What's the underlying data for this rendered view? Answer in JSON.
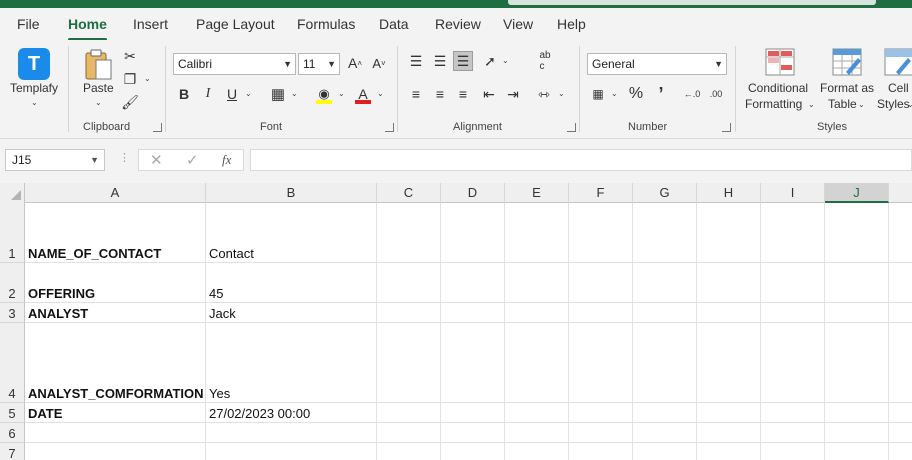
{
  "menu_tabs": [
    "File",
    "Home",
    "Insert",
    "Page Layout",
    "Formulas",
    "Data",
    "Review",
    "View",
    "Help"
  ],
  "ribbon": {
    "templafy": {
      "label": "Templafy",
      "icon": "templafy-logo-icon",
      "brand_color": "#1a8be8"
    },
    "clipboard": {
      "group_label": "Clipboard",
      "paste_label": "Paste"
    },
    "font": {
      "group_label": "Font",
      "font_name": "Calibri",
      "font_size": "11",
      "highlight_color": "#ffff00",
      "font_color": "#e02020"
    },
    "alignment": {
      "group_label": "Alignment"
    },
    "number": {
      "group_label": "Number",
      "format": "General"
    },
    "styles": {
      "group_label": "Styles",
      "conditional_line1": "Conditional",
      "conditional_line2": "Formatting",
      "format_table_line1": "Format as",
      "format_table_line2": "Table",
      "cell_styles_line1": "Cell",
      "cell_styles_line2": "Styles"
    }
  },
  "formula_bar": {
    "name_box": "J15",
    "cancel_icon": "x-icon",
    "enter_icon": "check-icon",
    "fx_label": "fx",
    "content": ""
  },
  "columns": [
    "A",
    "B",
    "C",
    "D",
    "E",
    "F",
    "G",
    "H",
    "I",
    "J"
  ],
  "active_column": "J",
  "rows": [
    {
      "num": "1",
      "a": "NAME_OF_CONTACT",
      "b": "Contact"
    },
    {
      "num": "2",
      "a": "OFFERING",
      "b": "45"
    },
    {
      "num": "3",
      "a": "ANALYST",
      "b": "Jack"
    },
    {
      "num": "4",
      "a": "ANALYST_COMFORMATION",
      "b": "Yes"
    },
    {
      "num": "5",
      "a": "DATE",
      "b": "27/02/2023 00:00"
    },
    {
      "num": "6",
      "a": "",
      "b": ""
    },
    {
      "num": "7",
      "a": "",
      "b": ""
    }
  ],
  "accent_color": "#1e6e42"
}
